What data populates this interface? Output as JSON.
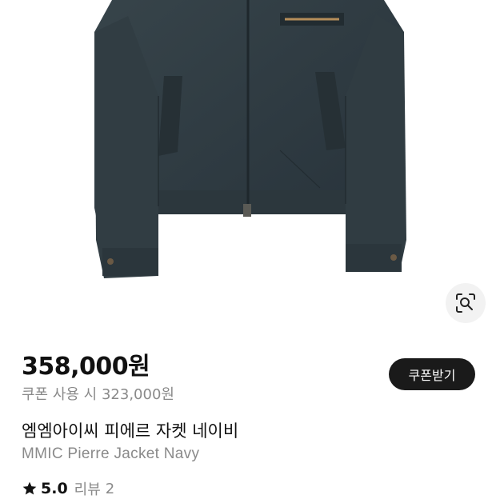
{
  "product": {
    "image_alt": "MMIC Pierre Jacket Navy",
    "price": "358,000원",
    "coupon_price_text": "쿠폰 사용 시 323,000원",
    "coupon_button_label": "쿠폰받기",
    "title_ko": "엠엠아이씨 피에르 자켓 네이비",
    "title_en": "MMIC Pierre Jacket Navy"
  },
  "rating": {
    "value": "5.0",
    "review_label": "리뷰",
    "review_count": "2"
  },
  "icons": {
    "lens": "image-search-icon",
    "star": "star-icon"
  },
  "colors": {
    "jacket": "#2f3a3e",
    "button_dark": "#1a1a1a",
    "muted_text": "#8a8a8a"
  }
}
